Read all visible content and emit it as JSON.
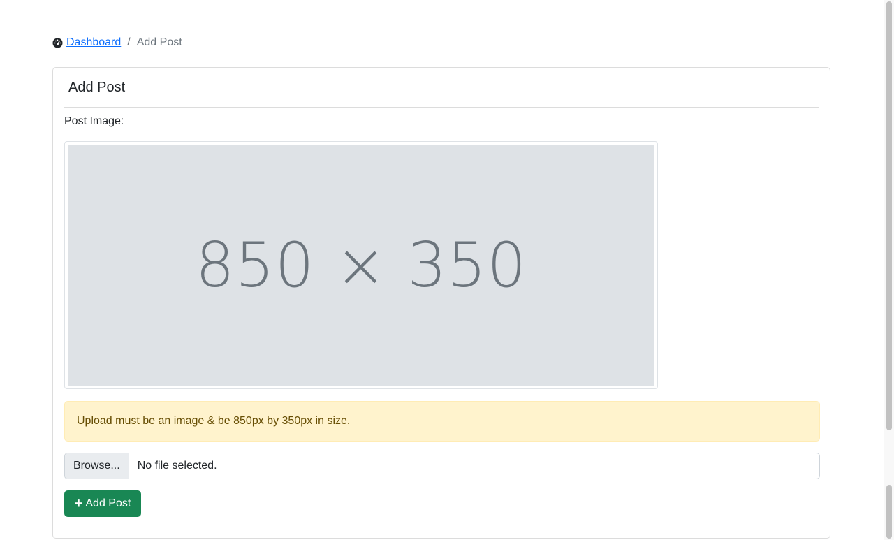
{
  "breadcrumb": {
    "icon": "dashboard-icon",
    "home_label": "Dashboard",
    "separator": "/",
    "current_label": "Add Post"
  },
  "card": {
    "title": "Add Post",
    "image_label": "Post Image:",
    "placeholder_text": "850 × 350",
    "alert_text": "Upload must be an image & be 850px by 350px in size.",
    "file_input": {
      "browse_label": "Browse...",
      "status_text": "No file selected."
    },
    "submit": {
      "icon": "plus-icon",
      "label": "Add Post"
    }
  },
  "colors": {
    "link": "#0d6efd",
    "success": "#198754",
    "alert_bg": "#fff3cd",
    "alert_text": "#664d03",
    "placeholder_bg": "#dee2e6",
    "placeholder_text": "#6c757d"
  }
}
